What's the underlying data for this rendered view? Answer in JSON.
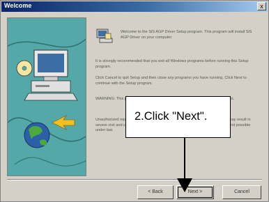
{
  "window": {
    "title": "Welcome",
    "close_label": "x"
  },
  "intro": "Welcome to the SiS AGP Driver Setup program. This program will install SiS AGP Driver on your computer.",
  "paragraphs": {
    "recommend": "It is strongly recommended that you exit all Windows programs before running this Setup program.",
    "cancel_info": "Click Cancel to quit Setup and then close any programs you have running. Click Next to continue with the Setup program.",
    "warning": "WARNING: This program is protected by copyright law and international treaties.",
    "unauthorized": "Unauthorized reproduction or distribution of this program, or any portion of it, may result in severe civil and criminal penalties, and will be prosecuted to the maximum extent possible under law."
  },
  "buttons": {
    "back": "< Back",
    "next": "Next >",
    "cancel": "Cancel"
  },
  "callout": {
    "text": "2.Click \"Next\"."
  },
  "colors": {
    "titlebar": "#0a246a",
    "art_panel": "#55a8a8",
    "dialog": "#d4d0c8"
  }
}
